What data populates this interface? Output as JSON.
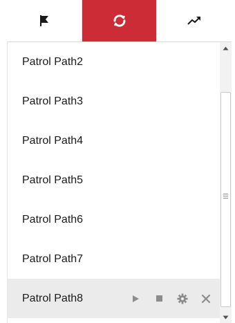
{
  "tabs": [
    {
      "icon": "flag-icon",
      "label": ""
    },
    {
      "icon": "refresh-icon",
      "label": "",
      "active": true
    },
    {
      "icon": "trend-icon",
      "label": ""
    }
  ],
  "colors": {
    "accent": "#cc2c36",
    "row_hover": "#ebebeb",
    "icon_gray": "#8c8c8c"
  },
  "patrol_paths": [
    {
      "label": "Patrol Path2"
    },
    {
      "label": "Patrol Path3"
    },
    {
      "label": "Patrol Path4"
    },
    {
      "label": "Patrol Path5"
    },
    {
      "label": "Patrol Path6"
    },
    {
      "label": "Patrol Path7"
    },
    {
      "label": "Patrol Path8",
      "hovered": true
    }
  ],
  "row_actions": [
    "play-icon",
    "stop-icon",
    "gear-icon",
    "close-icon"
  ]
}
